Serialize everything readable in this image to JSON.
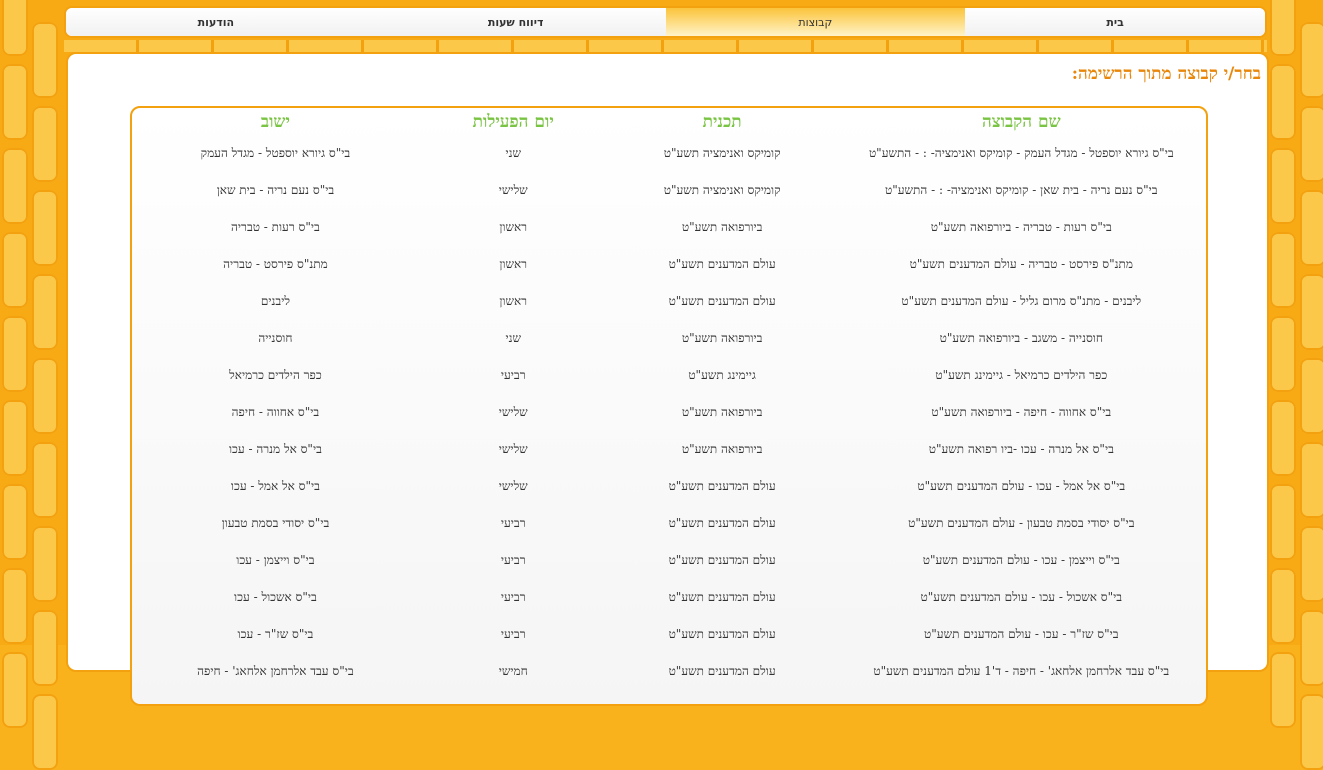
{
  "nav": {
    "tabs": [
      {
        "label": "בית",
        "active": false
      },
      {
        "label": "קבוצות",
        "active": true
      },
      {
        "label": "דיווח שעות",
        "active": false
      },
      {
        "label": "הודעות",
        "active": false
      }
    ]
  },
  "prompt": "בחר/י קבוצה מתוך הרשימה:",
  "table": {
    "headers": [
      "שם הקבוצה",
      "תכנית",
      "יום הפעילות",
      "ישוב"
    ],
    "rows": [
      [
        "בי\"ס גיורא יוספטל - מגדל העמק - קומיקס ואנימציה- : - התשע\"ט",
        "קומיקס ואנימציה תשע\"ט",
        "שני",
        "בי\"ס גיורא יוספטל - מגדל העמק"
      ],
      [
        "בי\"ס נעם נריה - בית שאן - קומיקס ואנימציה- : - התשע\"ט",
        "קומיקס ואנימציה תשע\"ט",
        "שלישי",
        "בי\"ס נעם נריה - בית שאן"
      ],
      [
        "בי\"ס רעות - טבריה - ביורפואה תשע\"ט",
        "ביורפואה תשע\"ט",
        "ראשון",
        "בי\"ס רעות - טבריה"
      ],
      [
        "מתנ\"ס פירסט - טבריה - עולם המדענים תשע\"ט",
        "עולם המדענים תשע\"ט",
        "ראשון",
        "מתנ\"ס פירסט - טבריה"
      ],
      [
        "ליבנים - מתנ\"ס מרום גליל - עולם המדענים תשע\"ט",
        "עולם המדענים תשע\"ט",
        "ראשון",
        "ליבנים"
      ],
      [
        "חוסנייה - משגב - ביורפואה תשע\"ט",
        "ביורפואה תשע\"ט",
        "שני",
        "חוסנייה"
      ],
      [
        "כפר הילדים כרמיאל - גיימינג תשע\"ט",
        "גיימינג תשע\"ט",
        "רביעי",
        "כפר הילדים כרמיאל"
      ],
      [
        "בי\"ס אחווה - חיפה - ביורפואה תשע\"ט",
        "ביורפואה תשע\"ט",
        "שלישי",
        "בי\"ס אחווה - חיפה"
      ],
      [
        "בי\"ס אל מנרה - עכו -ביו רפואה תשע\"ט",
        "ביורפואה תשע\"ט",
        "שלישי",
        "בי\"ס אל מנרה - עכו"
      ],
      [
        "בי\"ס אל אמל - עכו - עולם המדענים תשע\"ט",
        "עולם המדענים תשע\"ט",
        "שלישי",
        "בי\"ס אל אמל - עכו"
      ],
      [
        "בי\"ס יסודי בסמת טבעון - עולם המדענים תשע\"ט",
        "עולם המדענים תשע\"ט",
        "רביעי",
        "בי\"ס יסודי בסמת טבעון"
      ],
      [
        "בי\"ס וייצמן - עכו - עולם המדענים תשע\"ט",
        "עולם המדענים תשע\"ט",
        "רביעי",
        "בי\"ס וייצמן - עכו"
      ],
      [
        "בי\"ס אשכול - עכו - עולם המדענים תשע\"ט",
        "עולם המדענים תשע\"ט",
        "רביעי",
        "בי\"ס אשכול - עכו"
      ],
      [
        "בי\"ס שז\"ר - עכו - עולם המדענים תשע\"ט",
        "עולם המדענים תשע\"ט",
        "רביעי",
        "בי\"ס שז\"ר - עכו"
      ],
      [
        "בי\"ס עבד אלרחמן אלחאג' - חיפה - ד'1 עולם המדענים תשע\"ט",
        "עולם המדענים תשע\"ט",
        "חמישי",
        "בי\"ס עבד אלרחמן אלחאג' - חיפה"
      ]
    ]
  }
}
